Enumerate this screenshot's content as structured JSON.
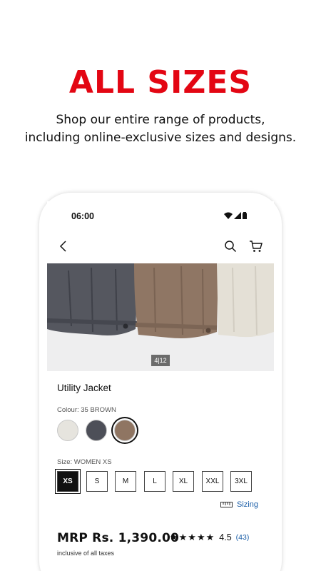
{
  "promo": {
    "headline": "ALL SIZES",
    "subline_1": "Shop our entire range of products,",
    "subline_2": "including online-exclusive sizes and designs."
  },
  "status_bar": {
    "time": "06:00"
  },
  "nav": {
    "icons": [
      "back-arrow-icon",
      "search-icon",
      "cart-icon"
    ]
  },
  "gallery": {
    "counter": "4|12"
  },
  "product": {
    "name": "Utility Jacket",
    "colour_label": "Colour: 35 BROWN",
    "colours": [
      {
        "name": "off-white",
        "hex": "#e6e4de"
      },
      {
        "name": "gray",
        "hex": "#4d4f58"
      },
      {
        "name": "brown",
        "hex": "#8f7562",
        "selected": true
      }
    ],
    "size_label": "Size: WOMEN XS",
    "sizes": [
      "XS",
      "S",
      "M",
      "L",
      "XL",
      "XXL",
      "3XL"
    ],
    "selected_size": "XS",
    "sizing_link": "Sizing",
    "price": "MRP Rs. 1,390.00",
    "tax_note": "inclusive of all taxes",
    "rating": {
      "stars": "★★★★★",
      "value": "4.5",
      "count": "(43)",
      "score": 4.5
    }
  },
  "colors": {
    "brand_red": "#e30613",
    "link_blue": "#1c5fa8"
  }
}
